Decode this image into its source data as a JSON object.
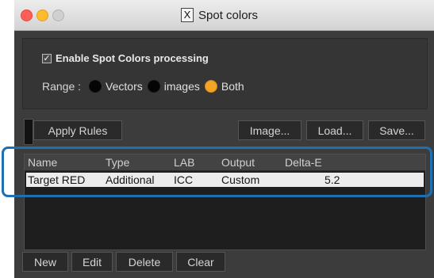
{
  "window": {
    "title": "Spot colors",
    "title_icon_glyph": "X"
  },
  "enable_option": {
    "label": "Enable Spot Colors processing",
    "checked": true
  },
  "range": {
    "label": "Range :",
    "options": [
      {
        "label": "Vectors",
        "selected": false
      },
      {
        "label": "images",
        "selected": false
      },
      {
        "label": "Both",
        "selected": true
      }
    ]
  },
  "toolbar": {
    "apply_rules": "Apply Rules",
    "image": "Image...",
    "load": "Load...",
    "save": "Save..."
  },
  "table": {
    "columns": [
      "Name",
      "Type",
      "LAB",
      "Output",
      "Delta-E"
    ],
    "rows": [
      {
        "name": "Target RED",
        "type": "Additional",
        "lab": "ICC",
        "output": "Custom",
        "delta_e": "5.2"
      }
    ]
  },
  "bottom_buttons": {
    "new": "New",
    "edit": "Edit",
    "delete": "Delete",
    "clear": "Clear"
  },
  "colors": {
    "accent_radio": "#f1a425",
    "highlight_outline": "#1f6fb3",
    "selected_row": "#ececec"
  }
}
